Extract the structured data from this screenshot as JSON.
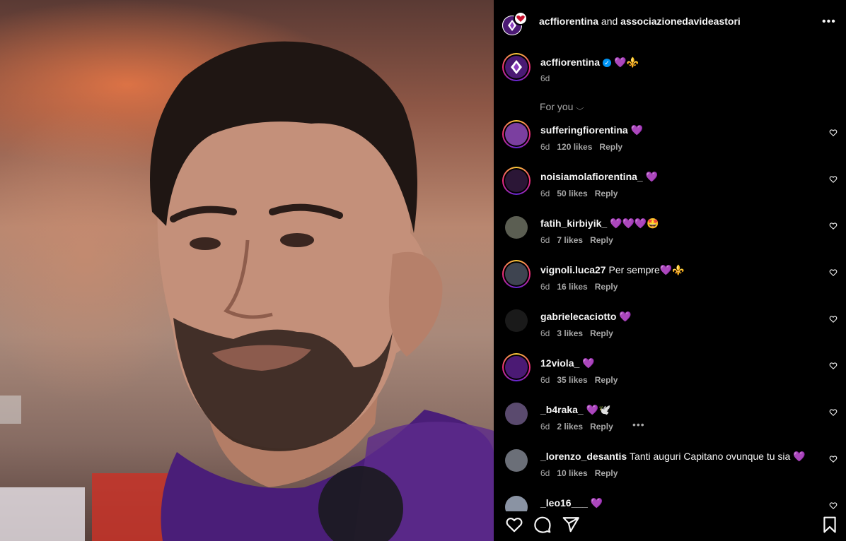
{
  "post": {
    "header": {
      "owner": "acffiorentina",
      "joiner": "and",
      "collaborator": "associazionedavideastori",
      "more_icon": "more-horizontal-icon"
    },
    "caption": {
      "username": "acffiorentina",
      "verified": true,
      "text": "💜⚜️",
      "time": "6d"
    },
    "sort_label": "For you",
    "comments": [
      {
        "username": "sufferingfiorentina",
        "text": "💜",
        "time": "6d",
        "likes": "120 likes",
        "reply": "Reply",
        "avatar_color": "#7b3fa0",
        "ring": true
      },
      {
        "username": "noisiamolafiorentina_",
        "text": "💜",
        "time": "6d",
        "likes": "50 likes",
        "reply": "Reply",
        "avatar_color": "#2b1636",
        "ring": true
      },
      {
        "username": "fatih_kirbiyik_",
        "text": "💜💜💜🤩",
        "time": "6d",
        "likes": "7 likes",
        "reply": "Reply",
        "avatar_color": "#5b5e52",
        "ring": false
      },
      {
        "username": "vignoli.luca27",
        "text": "Per sempre💜⚜️",
        "time": "6d",
        "likes": "16 likes",
        "reply": "Reply",
        "avatar_color": "#3e4450",
        "ring": true
      },
      {
        "username": "gabrielecaciotto",
        "text": "💜",
        "time": "6d",
        "likes": "3 likes",
        "reply": "Reply",
        "avatar_color": "#1a1a1a",
        "ring": false
      },
      {
        "username": "12viola_",
        "text": "💜",
        "time": "6d",
        "likes": "35 likes",
        "reply": "Reply",
        "avatar_color": "#4b1a74",
        "ring": true
      },
      {
        "username": "_b4raka_",
        "text": "💜🕊️",
        "time": "6d",
        "likes": "2 likes",
        "reply": "Reply",
        "avatar_color": "#5a4a6e",
        "ring": false,
        "more": "•••"
      },
      {
        "username": "_lorenzo_desantis",
        "text": "Tanti auguri Capitano ovunque tu sia 💜",
        "time": "6d",
        "likes": "10 likes",
        "reply": "Reply",
        "avatar_color": "#6b6f78",
        "ring": false
      },
      {
        "username": "_leo16___",
        "text": "💜",
        "time": "",
        "likes": "",
        "reply": "",
        "avatar_color": "#8a93a3",
        "ring": false
      }
    ],
    "actions": {
      "like_icon": "heart-outline-icon",
      "comment_icon": "comment-bubble-icon",
      "share_icon": "share-paper-plane-icon",
      "save_icon": "bookmark-icon"
    }
  },
  "colors": {
    "background": "#000000",
    "text": "#f5f5f5",
    "secondary_text": "#a8a8a8",
    "verified": "#0095f6",
    "fiorentina_purple": "#5b2a86"
  }
}
